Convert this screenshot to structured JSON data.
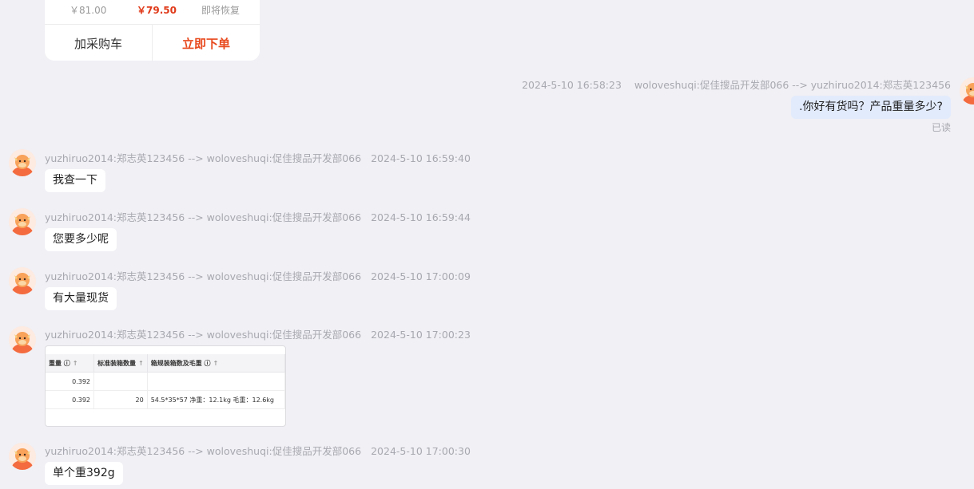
{
  "product_card": {
    "price_original": "￥81.00",
    "price_current": "￥79.50",
    "status": "即将恢复",
    "add_to_cart_label": "加采购车",
    "order_now_label": "立即下单",
    "accent_color": "#e8491d"
  },
  "messages": [
    {
      "direction": "outgoing",
      "time": "2024-5-10 16:58:23",
      "route": "woloveshuqi:促佳搜品开发部066 --> yuzhiruo2014:郑志英123456",
      "text": ".你好有货吗？产品重量多少?",
      "read_status": "已读"
    },
    {
      "direction": "incoming",
      "route": "yuzhiruo2014:郑志英123456 --> woloveshuqi:促佳搜品开发部066",
      "time": "2024-5-10 16:59:40",
      "text": "我查一下"
    },
    {
      "direction": "incoming",
      "route": "yuzhiruo2014:郑志英123456 --> woloveshuqi:促佳搜品开发部066",
      "time": "2024-5-10 16:59:44",
      "text": "您要多少呢"
    },
    {
      "direction": "incoming",
      "route": "yuzhiruo2014:郑志英123456 --> woloveshuqi:促佳搜品开发部066",
      "time": "2024-5-10 17:00:09",
      "text": "有大量现货"
    },
    {
      "direction": "incoming",
      "route": "yuzhiruo2014:郑志英123456 --> woloveshuqi:促佳搜品开发部066",
      "time": "2024-5-10 17:00:23",
      "image_table": {
        "headers": [
          "重量",
          "标准装箱数量",
          "箱规装箱数及毛重"
        ],
        "rows": [
          [
            "0.392",
            "",
            ""
          ],
          [
            "0.392",
            "20",
            "54.5*35*57 净重：12.1kg 毛重：12.6kg"
          ]
        ]
      }
    },
    {
      "direction": "incoming",
      "route": "yuzhiruo2014:郑志英123456 --> woloveshuqi:促佳搜品开发部066",
      "time": "2024-5-10 17:00:30",
      "text": "单个重392g"
    }
  ]
}
